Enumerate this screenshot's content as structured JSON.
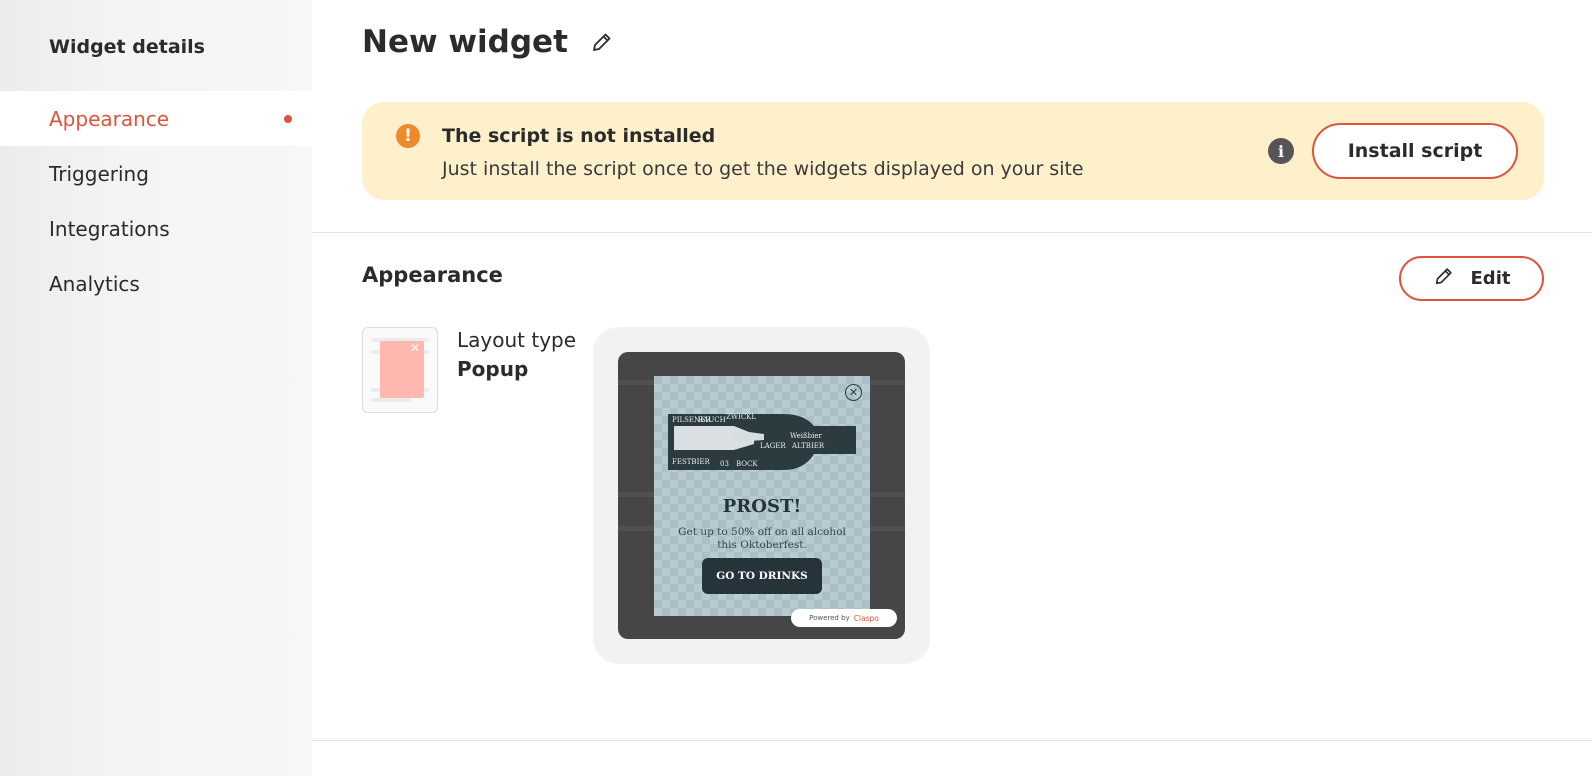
{
  "sidebar": {
    "title": "Widget details",
    "items": [
      {
        "label": "Appearance",
        "active": true
      },
      {
        "label": "Triggering"
      },
      {
        "label": "Integrations"
      },
      {
        "label": "Analytics"
      }
    ]
  },
  "header": {
    "title": "New widget",
    "edit_icon": "pencil-icon"
  },
  "banner": {
    "icon": "warning-icon",
    "title": "The script is not installed",
    "text": "Just install the script once to get the widgets displayed on your site",
    "info_icon": "info-icon",
    "button_label": "Install script"
  },
  "appearance": {
    "section_title": "Appearance",
    "edit_label": "Edit",
    "layout_type_label": "Layout type",
    "layout_type_value": "Popup",
    "preview": {
      "art_labels": [
        "PILSENER",
        "RAUCH",
        "ZWICKL",
        "LAGER",
        "Weißbier",
        "ALTBIER",
        "FESTBIER",
        "03",
        "BOCK"
      ],
      "heading": "PROST!",
      "body": "Get up to 50% off on all alcohol this Oktoberfest.",
      "cta": "GO TO DRINKS",
      "powered_by": "Powered by",
      "brand": "Claspo"
    }
  },
  "colors": {
    "accent": "#e0533b",
    "banner_bg": "#fff0cc",
    "warning": "#ef8a2a",
    "popup_bg": "#a9c0c7",
    "popup_dark": "#25343a"
  }
}
